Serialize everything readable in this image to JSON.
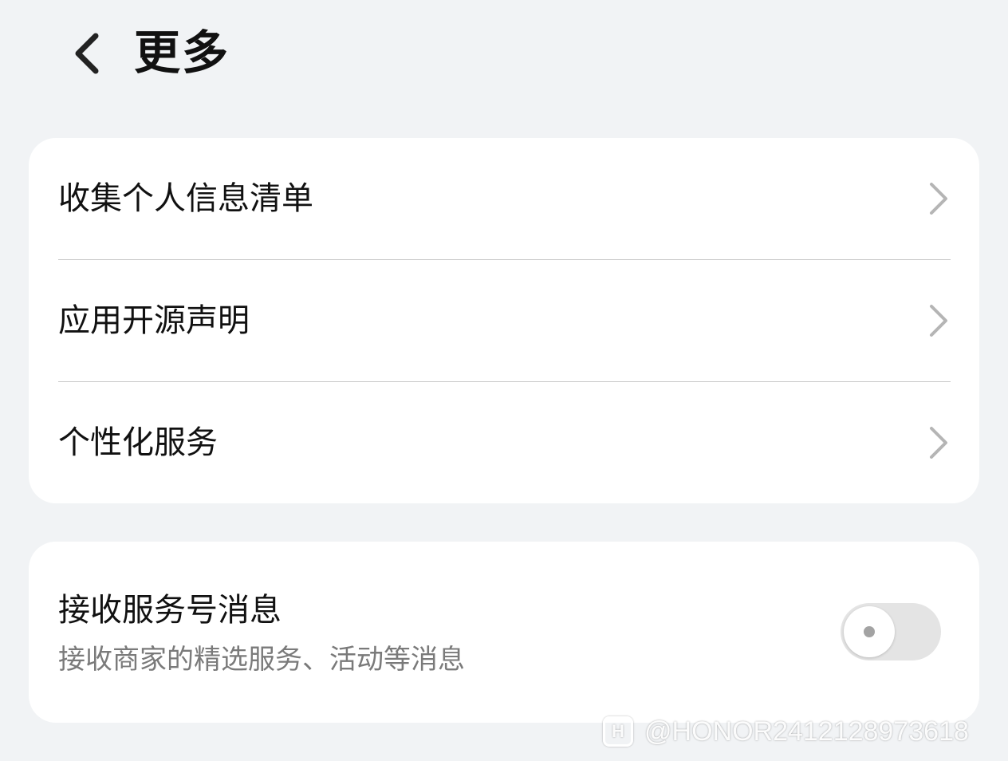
{
  "header": {
    "back_icon": "chevron-left-icon",
    "title": "更多"
  },
  "card_links": {
    "items": [
      {
        "label": "收集个人信息清单",
        "icon": "chevron-right-icon"
      },
      {
        "label": "应用开源声明",
        "icon": "chevron-right-icon"
      },
      {
        "label": "个性化服务",
        "icon": "chevron-right-icon"
      }
    ]
  },
  "card_toggle": {
    "title": "接收服务号消息",
    "subtitle": "接收商家的精选服务、活动等消息",
    "checked": false
  },
  "watermark": {
    "logo_text": "H",
    "text": "@HONOR2412128973618"
  },
  "colors": {
    "background": "#f1f3f5",
    "card": "#ffffff",
    "divider": "#c9c9c9",
    "chevron": "#b5b5b5",
    "subtitle": "#7a7a7a",
    "switch_off": "#e4e4e4"
  }
}
